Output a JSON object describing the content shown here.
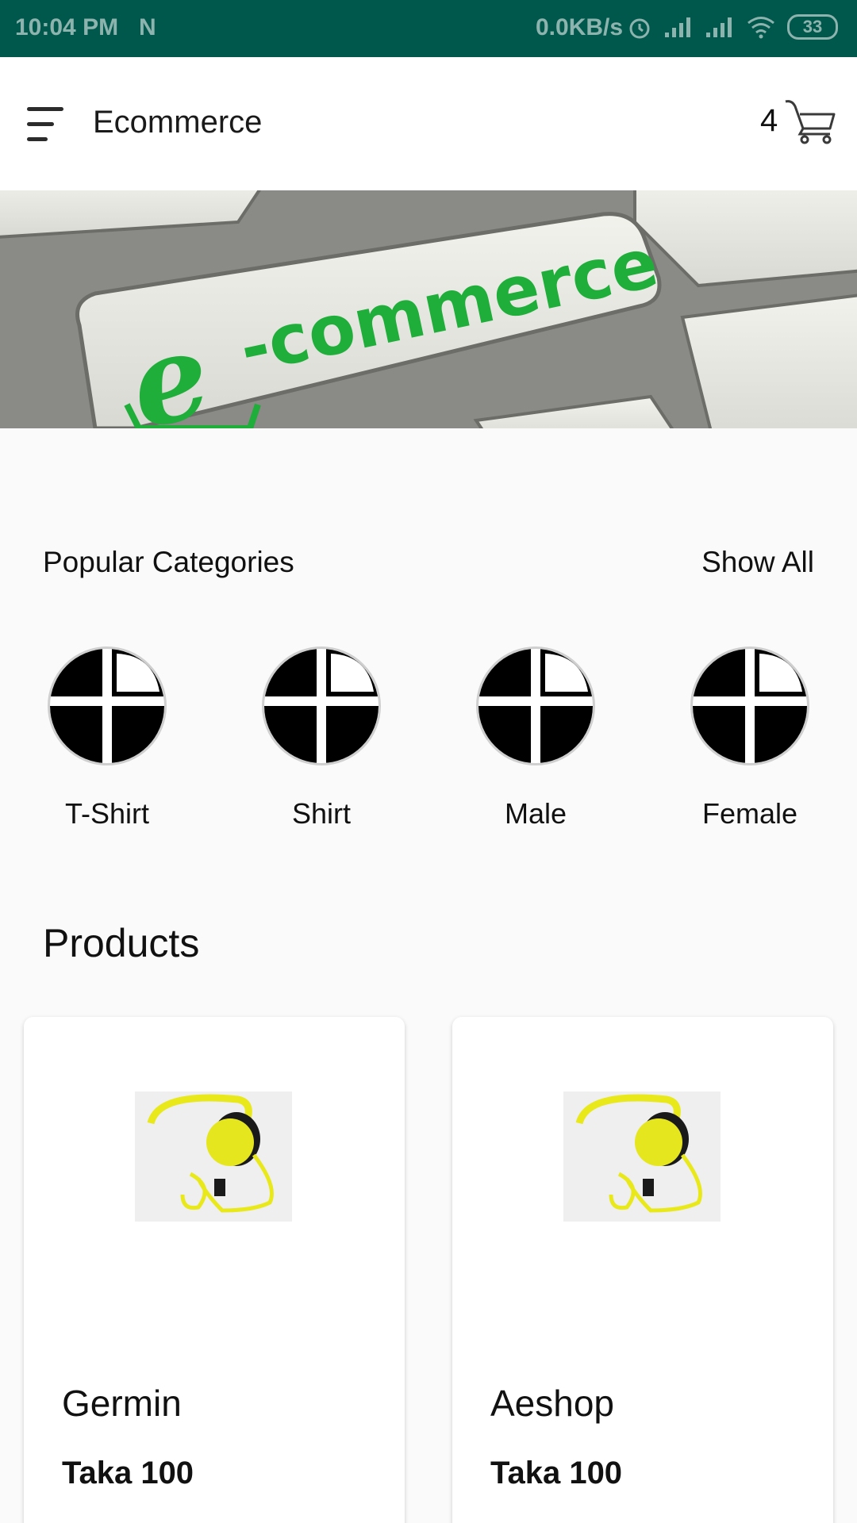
{
  "status_bar": {
    "time": "10:04 PM",
    "net_icon": "N",
    "speed": "0.0KB/s",
    "battery": "33",
    "icons": [
      "alarm-icon",
      "signal-icon",
      "signal-icon",
      "wifi-icon",
      "battery-icon"
    ]
  },
  "app_bar": {
    "title": "Ecommerce",
    "cart_count": "4",
    "menu_icon": "menu-icon",
    "cart_icon": "cart-icon"
  },
  "banner": {
    "text": "-commerce",
    "logo_letter": "e",
    "accent_color": "#1fae3a"
  },
  "categories": {
    "title": "Popular Categories",
    "show_all": "Show All",
    "items": [
      {
        "label": "T-Shirt"
      },
      {
        "label": "Shirt"
      },
      {
        "label": "Male"
      },
      {
        "label": "Female"
      }
    ]
  },
  "products": {
    "title": "Products",
    "items": [
      {
        "name": "Germin",
        "price": "Taka  100"
      },
      {
        "name": "Aeshop",
        "price": "Taka  100"
      }
    ]
  }
}
